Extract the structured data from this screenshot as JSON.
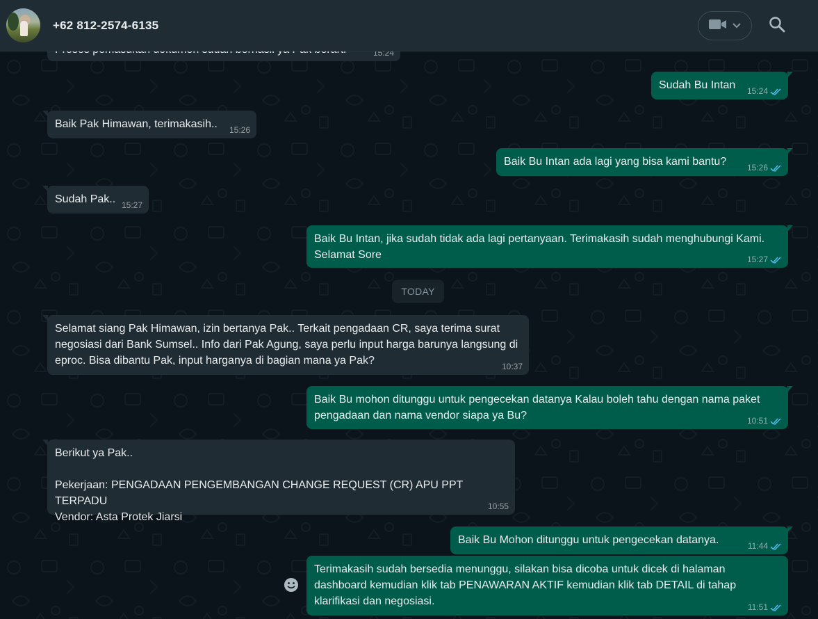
{
  "header": {
    "contact_name": "+62 812-2574-6135",
    "avatar_icon": "contact-avatar",
    "video_icon": "video-camera-icon",
    "dropdown_icon": "chevron-down-icon",
    "search_icon": "search-icon"
  },
  "colors": {
    "background": "#0b141a",
    "header": "#202c33",
    "incoming_bubble": "#202c33",
    "outgoing_bubble": "#005c4b",
    "read_ticks": "#53bdeb"
  },
  "date_separator": "TODAY",
  "messages": [
    {
      "direction": "in",
      "text": "Proses pemasukan dokumen sudah berhasil ya Pak berarti",
      "time": "15:24"
    },
    {
      "direction": "out",
      "text": "Sudah Bu Intan",
      "time": "15:24",
      "status": "read"
    },
    {
      "direction": "in",
      "text": "Baik Pak Himawan, terimakasih..",
      "time": "15:26"
    },
    {
      "direction": "out",
      "text": "Baik Bu Intan ada lagi yang bisa kami bantu?",
      "time": "15:26",
      "status": "read"
    },
    {
      "direction": "in",
      "text": "Sudah Pak..",
      "time": "15:27"
    },
    {
      "direction": "out",
      "text": "Baik Bu Intan, jika sudah tidak ada lagi pertanyaan. Terimakasih sudah menghubungi Kami. Selamat Sore",
      "time": "15:27",
      "status": "read"
    },
    {
      "direction": "in",
      "text": "Selamat siang Pak Himawan, izin bertanya Pak.. Terkait pengadaan CR, saya terima surat negosiasi dari Bank Sumsel.. Info dari Pak Agung, saya perlu input harga barunya langsung di eproc. Bisa dibantu Pak, input harganya di bagian mana ya Pak?",
      "time": "10:37"
    },
    {
      "direction": "out",
      "text": "Baik Bu mohon ditunggu untuk pengecekan datanya Kalau boleh tahu dengan nama paket pengadaan dan nama vendor siapa ya Bu?",
      "time": "10:51",
      "status": "read"
    },
    {
      "direction": "in",
      "text": "Berikut ya Pak..\n\nPekerjaan: PENGADAAN PENGEMBANGAN CHANGE REQUEST (CR) APU PPT TERPADU\nVendor: Asta Protek Jiarsi",
      "time": "10:55"
    },
    {
      "direction": "out",
      "text": "Baik Bu Mohon ditunggu untuk pengecekan datanya.",
      "time": "11:44",
      "status": "read"
    },
    {
      "direction": "out",
      "text": "Terimakasih sudah bersedia menunggu, silakan bisa dicoba untuk dicek di halaman dashboard kemudian klik tab PENAWARAN AKTIF kemudian klik tab DETAIL di tahap klarifikasi dan negosiasi.",
      "time": "11:51",
      "status": "read"
    }
  ],
  "emoji_icon": "smiley-icon"
}
